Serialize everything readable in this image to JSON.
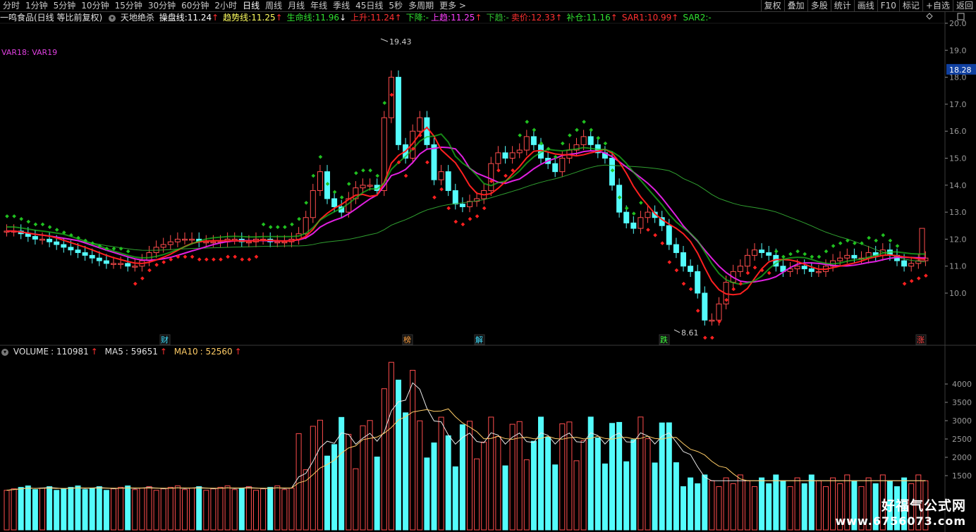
{
  "toolbar": {
    "periods": [
      "分时",
      "1分钟",
      "5分钟",
      "10分钟",
      "15分钟",
      "30分钟",
      "60分钟",
      "2小时",
      "日线",
      "周线",
      "月线",
      "年线",
      "季线",
      "45日线",
      "5秒",
      "多周期",
      "更多"
    ],
    "active_period": "日线",
    "right_buttons": [
      "复权",
      "叠加",
      "多股",
      "统计",
      "画线",
      "F10",
      "标记",
      "+自选",
      "返回"
    ]
  },
  "info": {
    "stock": "一鸣食品(日线 等比前复权)",
    "indicator": "天地绝杀",
    "items": [
      {
        "label": "操盘线",
        "value": "11.24",
        "arrow": "↑",
        "color": "#ffffff",
        "arrow_color": "#ff3030"
      },
      {
        "label": "趋势线",
        "value": "11.25",
        "arrow": "↑",
        "color": "#ffff60",
        "arrow_color": "#ff3030"
      },
      {
        "label": "生命线",
        "value": "11.96",
        "arrow": "↓",
        "color": "#30e030",
        "arrow_color": "#ffffff"
      },
      {
        "label": "上升",
        "value": "11.24",
        "arrow": "↑",
        "color": "#ff3030",
        "arrow_color": "#ff3030"
      },
      {
        "label": "下降",
        "value": "-",
        "arrow": "",
        "color": "#30e030",
        "arrow_color": ""
      },
      {
        "label": "上趋",
        "value": "11.25",
        "arrow": "↑",
        "color": "#ff40ff",
        "arrow_color": "#ff3030"
      },
      {
        "label": "下趋",
        "value": "-",
        "arrow": "",
        "color": "#30c030",
        "arrow_color": ""
      },
      {
        "label": "卖价",
        "value": "12.33",
        "arrow": "↑",
        "color": "#ff3030",
        "arrow_color": "#ff3030"
      },
      {
        "label": "补仓",
        "value": "11.16",
        "arrow": "↑",
        "color": "#30e030",
        "arrow_color": "#ff3030"
      },
      {
        "label": "SAR1",
        "value": "10.99",
        "arrow": "↑",
        "color": "#ff3030",
        "arrow_color": "#ff3030"
      },
      {
        "label": "SAR2",
        "value": "-",
        "arrow": "",
        "color": "#30e030",
        "arrow_color": ""
      }
    ],
    "var_label": "VAR18: VAR19"
  },
  "price_axis": {
    "ticks": [
      "20.0",
      "19.0",
      "18.0",
      "17.0",
      "16.0",
      "15.0",
      "14.0",
      "13.0",
      "12.0",
      "11.0",
      "10.0"
    ],
    "current": "18.28"
  },
  "annotations": {
    "high": "19.43",
    "low": "8.61"
  },
  "markers": [
    {
      "text": "财",
      "color": "#40e0ff"
    },
    {
      "text": "榜",
      "color": "#ffa040"
    },
    {
      "text": "解",
      "color": "#40e0ff"
    },
    {
      "text": "跌",
      "color": "#40ff40"
    },
    {
      "text": "涨",
      "color": "#ff4040"
    }
  ],
  "volume": {
    "name": "VOLUME",
    "value": "110981",
    "arrow": "↑",
    "ma5_label": "MA5",
    "ma5": "59651",
    "ma5_arrow": "↑",
    "ma10_label": "MA10",
    "ma10": "52560",
    "ma10_arrow": "↑",
    "ticks": [
      "4000",
      "3500",
      "3000",
      "2500",
      "2000",
      "1500"
    ]
  },
  "watermark": {
    "line1": "好福气公式网",
    "line2": "www.6756073.com"
  },
  "colors": {
    "up": "#ff4d4d",
    "down": "#54fcfc",
    "grid": "#3a3a3a",
    "axis": "#8a8a8a"
  }
}
